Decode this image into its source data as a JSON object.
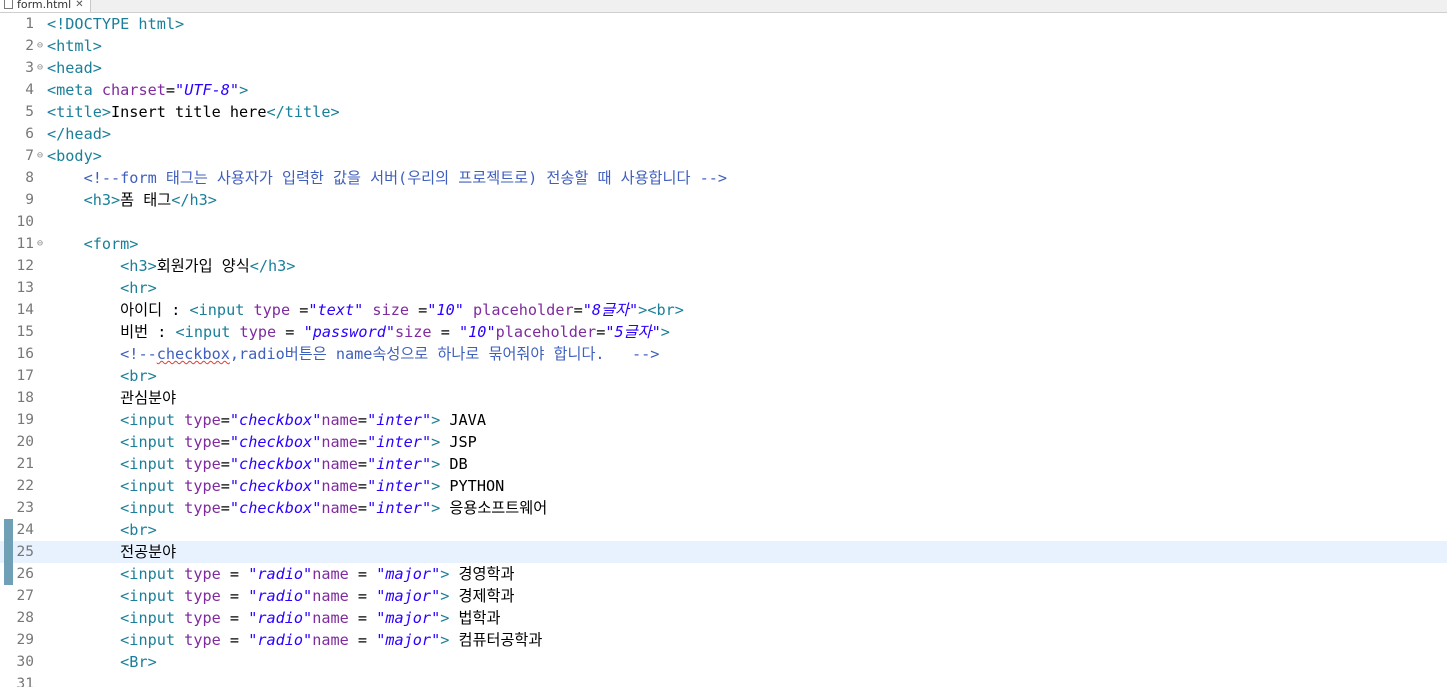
{
  "editor": {
    "tab_title": "form.html",
    "colors": {
      "tag": "#1a7f9a",
      "attribute": "#7f2a9e",
      "value": "#2a00ff",
      "comment": "#3f5fbf",
      "text": "#000000",
      "current_line": "#e8f2fe"
    },
    "current_line": 25,
    "lines": [
      {
        "n": "1",
        "fold": false,
        "tokens": [
          {
            "k": "t",
            "s": "<!DOCTYPE html>"
          }
        ]
      },
      {
        "n": "2",
        "fold": true,
        "tokens": [
          {
            "k": "t",
            "s": "<html>"
          }
        ]
      },
      {
        "n": "3",
        "fold": true,
        "tokens": [
          {
            "k": "t",
            "s": "<head>"
          }
        ]
      },
      {
        "n": "4",
        "fold": false,
        "tokens": [
          {
            "k": "t",
            "s": "<meta "
          },
          {
            "k": "a",
            "s": "charset"
          },
          {
            "k": "x",
            "s": "="
          },
          {
            "k": "v",
            "s": "\"UTF-8\""
          },
          {
            "k": "t",
            "s": ">"
          }
        ]
      },
      {
        "n": "5",
        "fold": false,
        "tokens": [
          {
            "k": "t",
            "s": "<title>"
          },
          {
            "k": "x",
            "s": "Insert title here"
          },
          {
            "k": "t",
            "s": "</title>"
          }
        ]
      },
      {
        "n": "6",
        "fold": false,
        "tokens": [
          {
            "k": "t",
            "s": "</head>"
          }
        ]
      },
      {
        "n": "7",
        "fold": true,
        "tokens": [
          {
            "k": "t",
            "s": "<body>"
          }
        ]
      },
      {
        "n": "8",
        "fold": false,
        "tokens": [
          {
            "k": "x",
            "s": "    "
          },
          {
            "k": "c",
            "s": "<!--form 태그는 사용자가 입력한 값을 서버(우리의 프로젝트로) 전송할 때 사용합니다 -->"
          }
        ]
      },
      {
        "n": "9",
        "fold": false,
        "tokens": [
          {
            "k": "x",
            "s": "    "
          },
          {
            "k": "t",
            "s": "<h3>"
          },
          {
            "k": "x",
            "s": "폼 태그"
          },
          {
            "k": "t",
            "s": "</h3>"
          }
        ]
      },
      {
        "n": "10",
        "fold": false,
        "tokens": []
      },
      {
        "n": "11",
        "fold": true,
        "tokens": [
          {
            "k": "x",
            "s": "    "
          },
          {
            "k": "t",
            "s": "<form>"
          }
        ]
      },
      {
        "n": "12",
        "fold": false,
        "tokens": [
          {
            "k": "x",
            "s": "        "
          },
          {
            "k": "t",
            "s": "<h3>"
          },
          {
            "k": "x",
            "s": "회원가입 양식"
          },
          {
            "k": "t",
            "s": "</h3>"
          }
        ]
      },
      {
        "n": "13",
        "fold": false,
        "tokens": [
          {
            "k": "x",
            "s": "        "
          },
          {
            "k": "t",
            "s": "<hr>"
          }
        ]
      },
      {
        "n": "14",
        "fold": false,
        "tokens": [
          {
            "k": "x",
            "s": "        아이디 : "
          },
          {
            "k": "t",
            "s": "<input "
          },
          {
            "k": "a",
            "s": "type "
          },
          {
            "k": "x",
            "s": "="
          },
          {
            "k": "v",
            "s": "\"text\""
          },
          {
            "k": "x",
            "s": " "
          },
          {
            "k": "a",
            "s": "size "
          },
          {
            "k": "x",
            "s": "="
          },
          {
            "k": "v",
            "s": "\"10\""
          },
          {
            "k": "x",
            "s": " "
          },
          {
            "k": "a",
            "s": "placeholder"
          },
          {
            "k": "x",
            "s": "="
          },
          {
            "k": "v",
            "s": "\"8글자\""
          },
          {
            "k": "t",
            "s": "><br>"
          }
        ]
      },
      {
        "n": "15",
        "fold": false,
        "tokens": [
          {
            "k": "x",
            "s": "        비번 : "
          },
          {
            "k": "t",
            "s": "<input "
          },
          {
            "k": "a",
            "s": "type "
          },
          {
            "k": "x",
            "s": "= "
          },
          {
            "k": "v",
            "s": "\"password\""
          },
          {
            "k": "a",
            "s": "size "
          },
          {
            "k": "x",
            "s": "= "
          },
          {
            "k": "v",
            "s": "\"10\""
          },
          {
            "k": "a",
            "s": "placeholder"
          },
          {
            "k": "x",
            "s": "="
          },
          {
            "k": "v",
            "s": "\"5글자\""
          },
          {
            "k": "t",
            "s": ">"
          }
        ]
      },
      {
        "n": "16",
        "fold": false,
        "tokens": [
          {
            "k": "x",
            "s": "        "
          },
          {
            "k": "c",
            "s": "<!--"
          },
          {
            "k": "cs",
            "s": "checkbox"
          },
          {
            "k": "c",
            "s": ",radio버튼은 name속성으로 하나로 묶어줘야 합니다.   -->"
          }
        ]
      },
      {
        "n": "17",
        "fold": false,
        "tokens": [
          {
            "k": "x",
            "s": "        "
          },
          {
            "k": "t",
            "s": "<br>"
          }
        ]
      },
      {
        "n": "18",
        "fold": false,
        "tokens": [
          {
            "k": "x",
            "s": "        관심분야"
          }
        ]
      },
      {
        "n": "19",
        "fold": false,
        "tokens": [
          {
            "k": "x",
            "s": "        "
          },
          {
            "k": "t",
            "s": "<input "
          },
          {
            "k": "a",
            "s": "type"
          },
          {
            "k": "x",
            "s": "="
          },
          {
            "k": "v",
            "s": "\"checkbox\""
          },
          {
            "k": "a",
            "s": "name"
          },
          {
            "k": "x",
            "s": "="
          },
          {
            "k": "v",
            "s": "\"inter\""
          },
          {
            "k": "t",
            "s": ">"
          },
          {
            "k": "x",
            "s": " JAVA"
          }
        ]
      },
      {
        "n": "20",
        "fold": false,
        "tokens": [
          {
            "k": "x",
            "s": "        "
          },
          {
            "k": "t",
            "s": "<input "
          },
          {
            "k": "a",
            "s": "type"
          },
          {
            "k": "x",
            "s": "="
          },
          {
            "k": "v",
            "s": "\"checkbox\""
          },
          {
            "k": "a",
            "s": "name"
          },
          {
            "k": "x",
            "s": "="
          },
          {
            "k": "v",
            "s": "\"inter\""
          },
          {
            "k": "t",
            "s": ">"
          },
          {
            "k": "x",
            "s": " JSP"
          }
        ]
      },
      {
        "n": "21",
        "fold": false,
        "tokens": [
          {
            "k": "x",
            "s": "        "
          },
          {
            "k": "t",
            "s": "<input "
          },
          {
            "k": "a",
            "s": "type"
          },
          {
            "k": "x",
            "s": "="
          },
          {
            "k": "v",
            "s": "\"checkbox\""
          },
          {
            "k": "a",
            "s": "name"
          },
          {
            "k": "x",
            "s": "="
          },
          {
            "k": "v",
            "s": "\"inter\""
          },
          {
            "k": "t",
            "s": ">"
          },
          {
            "k": "x",
            "s": " DB"
          }
        ]
      },
      {
        "n": "22",
        "fold": false,
        "tokens": [
          {
            "k": "x",
            "s": "        "
          },
          {
            "k": "t",
            "s": "<input "
          },
          {
            "k": "a",
            "s": "type"
          },
          {
            "k": "x",
            "s": "="
          },
          {
            "k": "v",
            "s": "\"checkbox\""
          },
          {
            "k": "a",
            "s": "name"
          },
          {
            "k": "x",
            "s": "="
          },
          {
            "k": "v",
            "s": "\"inter\""
          },
          {
            "k": "t",
            "s": ">"
          },
          {
            "k": "x",
            "s": " PYTHON"
          }
        ]
      },
      {
        "n": "23",
        "fold": false,
        "tokens": [
          {
            "k": "x",
            "s": "        "
          },
          {
            "k": "t",
            "s": "<input "
          },
          {
            "k": "a",
            "s": "type"
          },
          {
            "k": "x",
            "s": "="
          },
          {
            "k": "v",
            "s": "\"checkbox\""
          },
          {
            "k": "a",
            "s": "name"
          },
          {
            "k": "x",
            "s": "="
          },
          {
            "k": "v",
            "s": "\"inter\""
          },
          {
            "k": "t",
            "s": ">"
          },
          {
            "k": "x",
            "s": " 응용소프트웨어"
          }
        ]
      },
      {
        "n": "24",
        "fold": false,
        "tokens": [
          {
            "k": "x",
            "s": "        "
          },
          {
            "k": "t",
            "s": "<br>"
          }
        ]
      },
      {
        "n": "25",
        "fold": false,
        "tokens": [
          {
            "k": "x",
            "s": "        전공분야"
          }
        ]
      },
      {
        "n": "26",
        "fold": false,
        "tokens": [
          {
            "k": "x",
            "s": "        "
          },
          {
            "k": "t",
            "s": "<input "
          },
          {
            "k": "a",
            "s": "type "
          },
          {
            "k": "x",
            "s": "= "
          },
          {
            "k": "v",
            "s": "\"radio\""
          },
          {
            "k": "a",
            "s": "name "
          },
          {
            "k": "x",
            "s": "= "
          },
          {
            "k": "v",
            "s": "\"major\""
          },
          {
            "k": "t",
            "s": ">"
          },
          {
            "k": "x",
            "s": " 경영학과"
          }
        ]
      },
      {
        "n": "27",
        "fold": false,
        "tokens": [
          {
            "k": "x",
            "s": "        "
          },
          {
            "k": "t",
            "s": "<input "
          },
          {
            "k": "a",
            "s": "type "
          },
          {
            "k": "x",
            "s": "= "
          },
          {
            "k": "v",
            "s": "\"radio\""
          },
          {
            "k": "a",
            "s": "name "
          },
          {
            "k": "x",
            "s": "= "
          },
          {
            "k": "v",
            "s": "\"major\""
          },
          {
            "k": "t",
            "s": ">"
          },
          {
            "k": "x",
            "s": " 경제학과"
          }
        ]
      },
      {
        "n": "28",
        "fold": false,
        "tokens": [
          {
            "k": "x",
            "s": "        "
          },
          {
            "k": "t",
            "s": "<input "
          },
          {
            "k": "a",
            "s": "type "
          },
          {
            "k": "x",
            "s": "= "
          },
          {
            "k": "v",
            "s": "\"radio\""
          },
          {
            "k": "a",
            "s": "name "
          },
          {
            "k": "x",
            "s": "= "
          },
          {
            "k": "v",
            "s": "\"major\""
          },
          {
            "k": "t",
            "s": ">"
          },
          {
            "k": "x",
            "s": " 법학과"
          }
        ]
      },
      {
        "n": "29",
        "fold": false,
        "tokens": [
          {
            "k": "x",
            "s": "        "
          },
          {
            "k": "t",
            "s": "<input "
          },
          {
            "k": "a",
            "s": "type "
          },
          {
            "k": "x",
            "s": "= "
          },
          {
            "k": "v",
            "s": "\"radio\""
          },
          {
            "k": "a",
            "s": "name "
          },
          {
            "k": "x",
            "s": "= "
          },
          {
            "k": "v",
            "s": "\"major\""
          },
          {
            "k": "t",
            "s": ">"
          },
          {
            "k": "x",
            "s": " 컴퓨터공학과"
          }
        ]
      },
      {
        "n": "30",
        "fold": false,
        "tokens": [
          {
            "k": "x",
            "s": "        "
          },
          {
            "k": "t",
            "s": "<Br>"
          }
        ]
      },
      {
        "n": "31",
        "fold": false,
        "tokens": []
      }
    ],
    "change_markers": [
      24,
      25,
      26
    ]
  }
}
